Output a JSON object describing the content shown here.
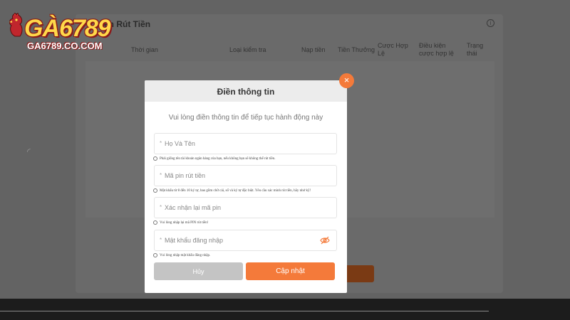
{
  "logo": {
    "main": "GÀ6789",
    "sub": "GA6789.CO.COM"
  },
  "background": {
    "title": "ện Rút Tiền",
    "columns": [
      {
        "line1": "Thời gian",
        "line2": ""
      },
      {
        "line1": "Loại kiểm tra",
        "line2": ""
      },
      {
        "line1": "Nạp tiền",
        "line2": ""
      },
      {
        "line1": "Tiền Thưởng",
        "line2": ""
      },
      {
        "line1": "Cược Hợp",
        "line2": "Lệ"
      },
      {
        "line1": "Điều kiện",
        "line2": "cược hợp lệ"
      },
      {
        "line1": "Trạng",
        "line2": "thái"
      }
    ]
  },
  "modal": {
    "title": "Điền thông tin",
    "close": "×",
    "subtitle": "Vui lòng điền thông tin để tiếp tục hành động này",
    "fields": [
      {
        "placeholder": "Họ Và Tên",
        "hint": "Phải giống tên tài khoản ngân hàng của bạn, nếu không bạn sẽ không thể rút tiền."
      },
      {
        "placeholder": "Mã pin rút tiền",
        "hint": "Mật khẩu từ 8 đến 10 ký tự, bao gồm chữ cái, số và ký tự đặc biệt. Yêu cầu xác minh rút tiền, hãy nhớ kỹ!"
      },
      {
        "placeholder": "Xác nhận lại mã pin",
        "hint": "Vui lòng nhập lại mã PIN rút tiền!"
      },
      {
        "placeholder": "Mật khẩu đăng nhập",
        "hint": "Vui lòng nhập mật khẩu đăng nhập."
      }
    ],
    "star": "*",
    "cancel_label": "Hủy",
    "update_label": "Cập nhật"
  },
  "colors": {
    "accent": "#f47a3a",
    "cancel": "#c4c4c4"
  }
}
